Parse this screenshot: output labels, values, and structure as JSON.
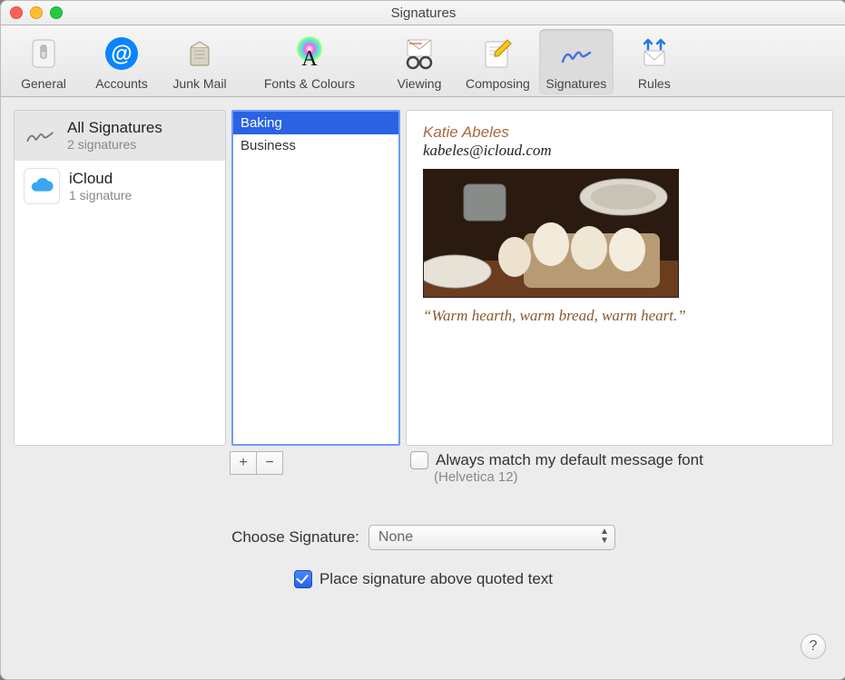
{
  "window": {
    "title": "Signatures"
  },
  "toolbar": {
    "general": "General",
    "accounts": "Accounts",
    "junk": "Junk Mail",
    "fonts": "Fonts & Colours",
    "viewing": "Viewing",
    "composing": "Composing",
    "signatures": "Signatures",
    "rules": "Rules",
    "selected": "signatures"
  },
  "accounts_col": {
    "items": [
      {
        "title": "All Signatures",
        "sub": "2 signatures",
        "selected": true
      },
      {
        "title": "iCloud",
        "sub": "1 signature",
        "selected": false
      }
    ]
  },
  "signatures_col": {
    "items": [
      {
        "name": "Baking",
        "selected": true
      },
      {
        "name": "Business",
        "selected": false
      }
    ]
  },
  "preview": {
    "name": "Katie Abeles",
    "email": "kabeles@icloud.com",
    "quote": "“Warm hearth, warm bread, warm heart.”"
  },
  "buttons": {
    "add": "+",
    "remove": "−"
  },
  "match_font": {
    "label": "Always match my default message font",
    "note": "(Helvetica 12)",
    "checked": false
  },
  "choose": {
    "label": "Choose Signature:",
    "value": "None"
  },
  "place_above": {
    "label": "Place signature above quoted text",
    "checked": true
  },
  "help": {
    "label": "?"
  }
}
